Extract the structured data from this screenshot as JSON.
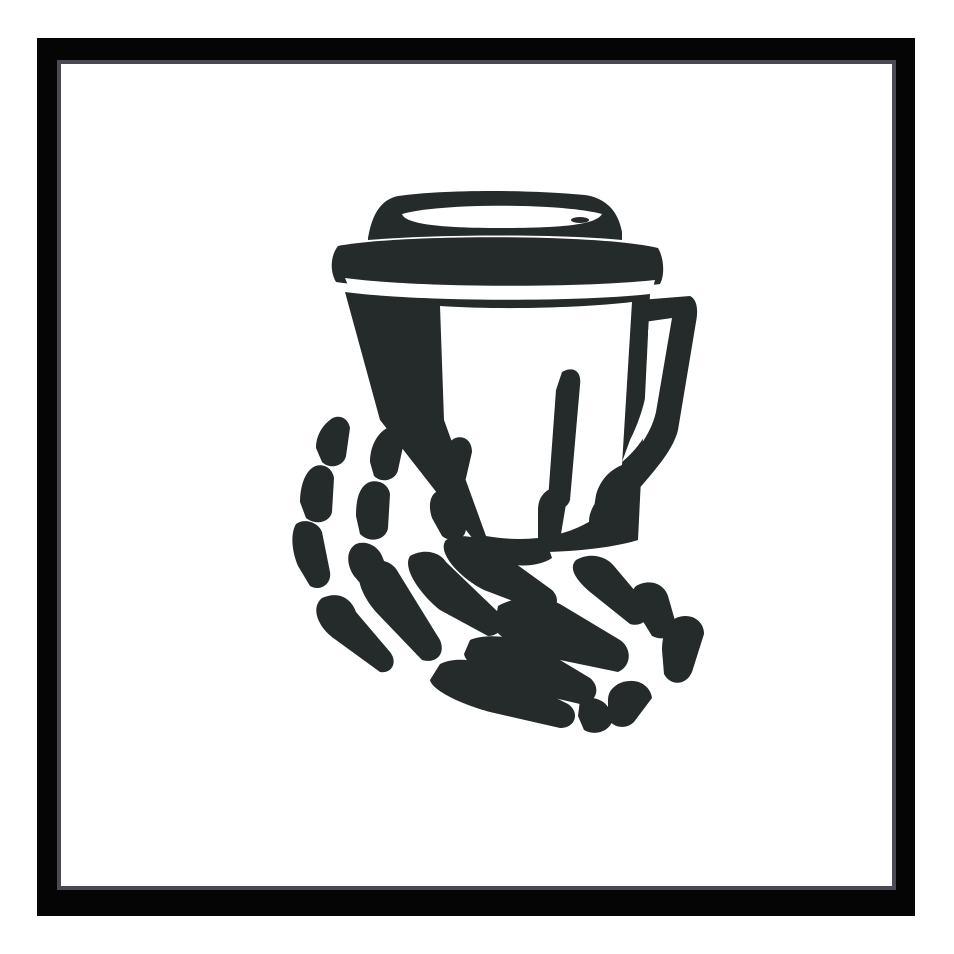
{
  "image": {
    "subject": "skeleton-hand-holding-coffee-cup",
    "colors": {
      "ink": "#252a2a",
      "frame": "#050505",
      "frame_edge": "#4a4a55",
      "paper": "#ffffff"
    },
    "icons": [
      "skeleton-hand-icon",
      "coffee-cup-icon"
    ]
  }
}
